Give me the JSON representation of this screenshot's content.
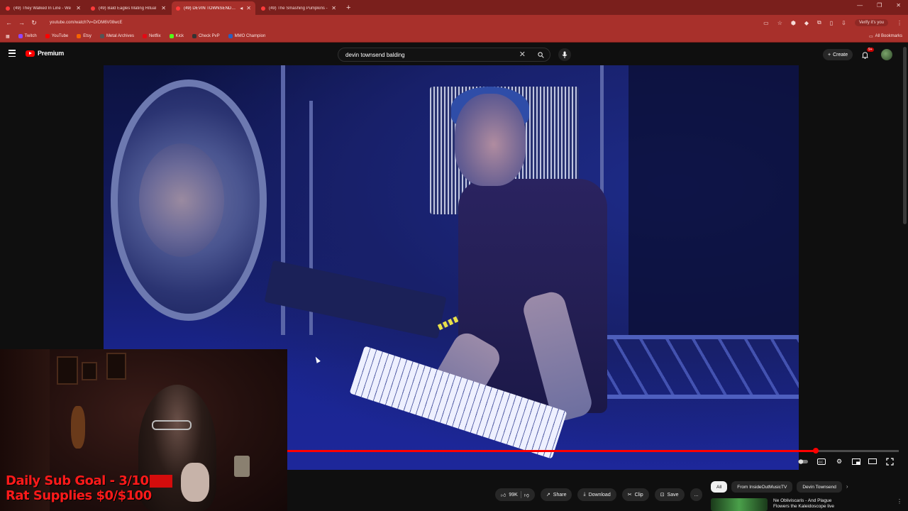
{
  "browser": {
    "tabs": [
      {
        "title": "(49) They Walked In Line - We"
      },
      {
        "title": "(49) Bald Eagles Mating Ritual"
      },
      {
        "title": "(49) DEVIN TOWNSEND PI"
      },
      {
        "title": "(49) The Smashing Pumpkins -"
      }
    ],
    "new_tab": "+",
    "url": "youtube.com/watch?v=DrDM6V08wcE",
    "verify_label": "Verify it's you",
    "bookmarks": [
      {
        "label": "Twitch",
        "color": "#9146ff"
      },
      {
        "label": "YouTube",
        "color": "#ff0000"
      },
      {
        "label": "Etsy",
        "color": "#f56400"
      },
      {
        "label": "Metal Archives",
        "color": "#555555"
      },
      {
        "label": "Netflix",
        "color": "#e50914"
      },
      {
        "label": "Kick",
        "color": "#53fc18"
      },
      {
        "label": "Check PvP",
        "color": "#333333"
      },
      {
        "label": "MMO Champion",
        "color": "#2a5fbf"
      }
    ],
    "all_bookmarks": "All Bookmarks"
  },
  "youtube": {
    "logo_text": "Premium",
    "search_query": "devin townsend balding",
    "create_label": "Create",
    "notif_count": "9+",
    "accent": "#ff0000"
  },
  "player": {
    "progress_fraction": 0.864
  },
  "overlay": {
    "line1": "Daily Sub Goal - 3/10",
    "line2": "Rat Supplies $0/$100"
  },
  "actions": {
    "likes": "99K",
    "share": "Share",
    "download": "Download",
    "clip": "Clip",
    "save": "Save",
    "more": "..."
  },
  "chips": [
    "All",
    "From InsideOutMusicTV",
    "Devin Townsend"
  ],
  "recommendation": {
    "title": "Ne Obliviscaris - And Plague",
    "subtitle": "Flowers the Kaleidoscope live"
  }
}
